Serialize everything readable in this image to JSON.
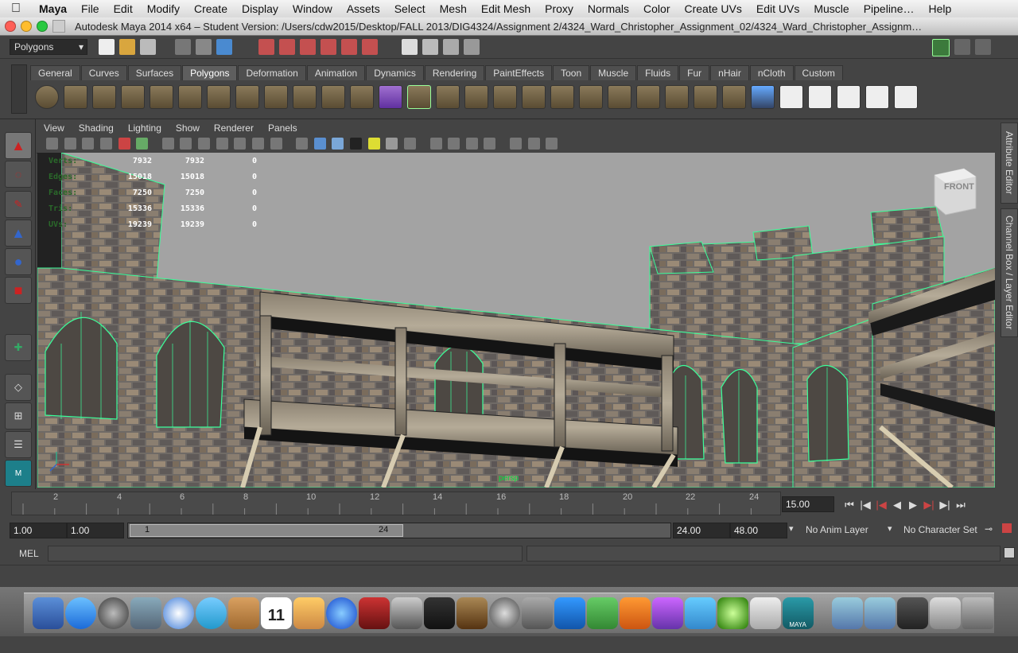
{
  "menubar": {
    "items": [
      "Maya",
      "File",
      "Edit",
      "Modify",
      "Create",
      "Display",
      "Window",
      "Assets",
      "Select",
      "Mesh",
      "Edit Mesh",
      "Proxy",
      "Normals",
      "Color",
      "Create UVs",
      "Edit UVs",
      "Muscle",
      "Pipeline…",
      "Help"
    ]
  },
  "window": {
    "title": "Autodesk Maya 2014 x64 – Student Version: /Users/cdw2015/Desktop/FALL 2013/DIG4324/Assignment 2/4324_Ward_Christopher_Assignment_02/4324_Ward_Christopher_Assignm…"
  },
  "statusline": {
    "menuset": "Polygons"
  },
  "shelf": {
    "tabs": [
      "General",
      "Curves",
      "Surfaces",
      "Polygons",
      "Deformation",
      "Animation",
      "Dynamics",
      "Rendering",
      "PaintEffects",
      "Toon",
      "Muscle",
      "Fluids",
      "Fur",
      "nHair",
      "nCloth",
      "Custom"
    ],
    "active_tab": "Polygons"
  },
  "panel": {
    "menus": [
      "View",
      "Shading",
      "Lighting",
      "Show",
      "Renderer",
      "Panels"
    ],
    "camera_label": "persp",
    "viewcube_label": "FRONT"
  },
  "hud": {
    "rows": [
      {
        "label": "Verts:",
        "a": "7932",
        "b": "7932",
        "c": "0"
      },
      {
        "label": "Edges:",
        "a": "15018",
        "b": "15018",
        "c": "0"
      },
      {
        "label": "Faces:",
        "a": "7250",
        "b": "7250",
        "c": "0"
      },
      {
        "label": "Tris:",
        "a": "15336",
        "b": "15336",
        "c": "0"
      },
      {
        "label": "UVs:",
        "a": "19239",
        "b": "19239",
        "c": "0"
      }
    ]
  },
  "timeslider": {
    "ticks": [
      "2",
      "4",
      "6",
      "8",
      "10",
      "12",
      "14",
      "16",
      "18",
      "20",
      "22",
      "24"
    ],
    "current_time": "15.00"
  },
  "range": {
    "start_time": "1.00",
    "playback_start": "1.00",
    "range_start": "1",
    "range_end": "24",
    "playback_end": "24.00",
    "end_time": "48.00",
    "anim_layer": "No Anim Layer",
    "character_set": "No Character Set"
  },
  "commandline": {
    "label": "MEL"
  },
  "rightbar": {
    "tab1": "Attribute Editor",
    "tab2": "Channel Box / Layer Editor"
  },
  "dock": {
    "calendar_day": "11",
    "maya_label": "MAYA"
  },
  "colors": {
    "wireframe": "#3aff9a",
    "menu_bg": "#444444",
    "sky": "#a3a3a3"
  }
}
